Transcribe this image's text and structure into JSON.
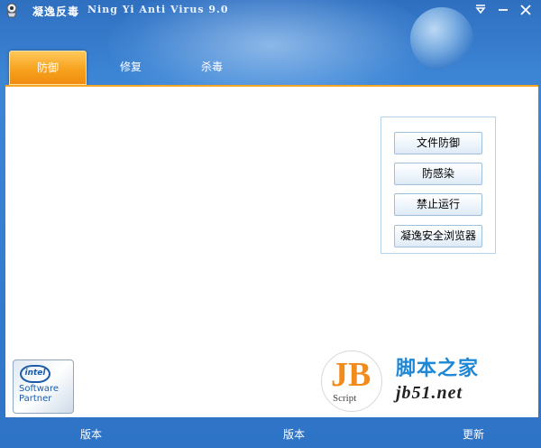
{
  "window": {
    "title": "凝逸反毒",
    "subtitle": "Ning Yi Anti Virus 9.0"
  },
  "tabs": [
    {
      "label": "防御",
      "active": true
    },
    {
      "label": "修复",
      "active": false
    },
    {
      "label": "杀毒",
      "active": false
    }
  ],
  "actions": {
    "file_defense": "文件防御",
    "anti_infection": "防感染",
    "block_run": "禁止运行",
    "safe_browser": "凝逸安全浏览器"
  },
  "logos": {
    "intel_mark": "intel",
    "intel_line1": "Software",
    "intel_line2": "Partner",
    "jb_mark": "JB",
    "jb_script": "Script",
    "jb_cn": "脚本之家",
    "jb_url": "jb51.net"
  },
  "footer": {
    "left": "版本",
    "center": "版本",
    "right": "更新"
  },
  "colors": {
    "accent_tab": "#f7a21e",
    "background_blue": "#2e73c6",
    "jb_orange": "#f08b1c",
    "jb_blue": "#1f88d6"
  }
}
